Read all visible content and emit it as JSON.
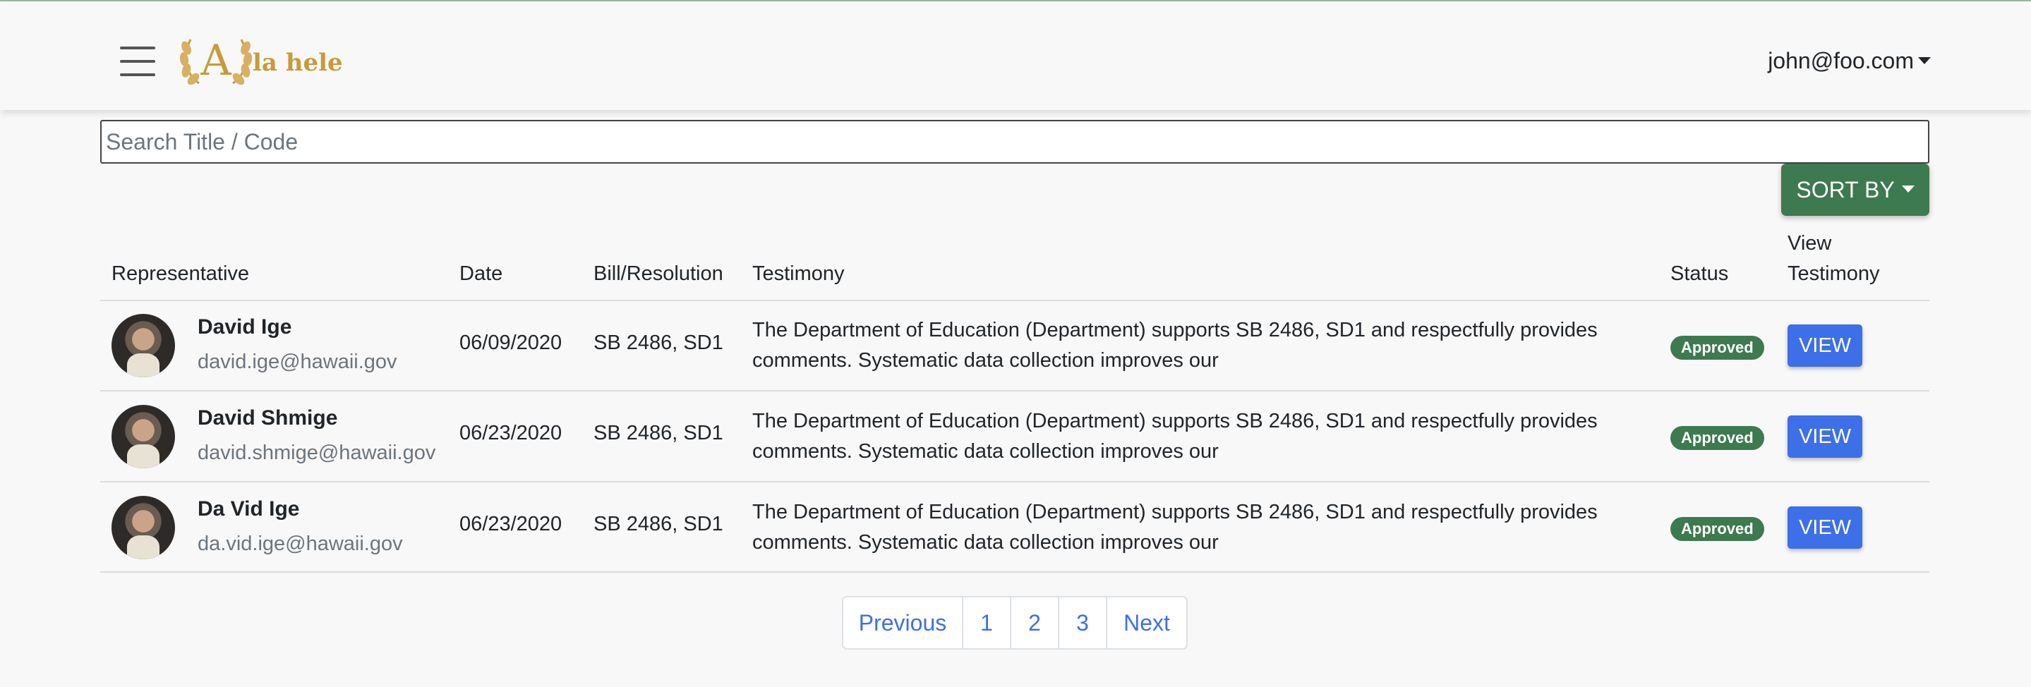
{
  "header": {
    "logo_text": "la hele",
    "user_email": "john@foo.com"
  },
  "search": {
    "placeholder": "Search Title / Code",
    "value": ""
  },
  "sort": {
    "label": "SORT BY"
  },
  "table": {
    "columns": {
      "representative": "Representative",
      "date": "Date",
      "bill": "Bill/Resolution",
      "testimony": "Testimony",
      "status": "Status",
      "view_line1": "View",
      "view_line2": "Testimony"
    },
    "rows": [
      {
        "name": "David Ige",
        "email": "david.ige@hawaii.gov",
        "date": "06/09/2020",
        "bill": "SB 2486, SD1",
        "testimony_line1": "The Department of Education (Department) supports SB 2486, SD1 and respectfully provides",
        "testimony_line2": "comments. Systematic data collection improves our",
        "status": "Approved",
        "view_label": "VIEW"
      },
      {
        "name": "David Shmige",
        "email": "david.shmige@hawaii.gov",
        "date": "06/23/2020",
        "bill": "SB 2486, SD1",
        "testimony_line1": "The Department of Education (Department) supports SB 2486, SD1 and respectfully provides",
        "testimony_line2": "comments. Systematic data collection improves our",
        "status": "Approved",
        "view_label": "VIEW"
      },
      {
        "name": "Da Vid Ige",
        "email": "da.vid.ige@hawaii.gov",
        "date": "06/23/2020",
        "bill": "SB 2486, SD1",
        "testimony_line1": "The Department of Education (Department) supports SB 2486, SD1 and respectfully provides",
        "testimony_line2": "comments. Systematic data collection improves our",
        "status": "Approved",
        "view_label": "VIEW"
      }
    ]
  },
  "pagination": {
    "previous": "Previous",
    "pages": [
      "1",
      "2",
      "3"
    ],
    "next": "Next"
  },
  "colors": {
    "primary_green": "#3d7a4f",
    "view_blue": "#3d6fe8",
    "logo_gold": "#c89a3a"
  }
}
